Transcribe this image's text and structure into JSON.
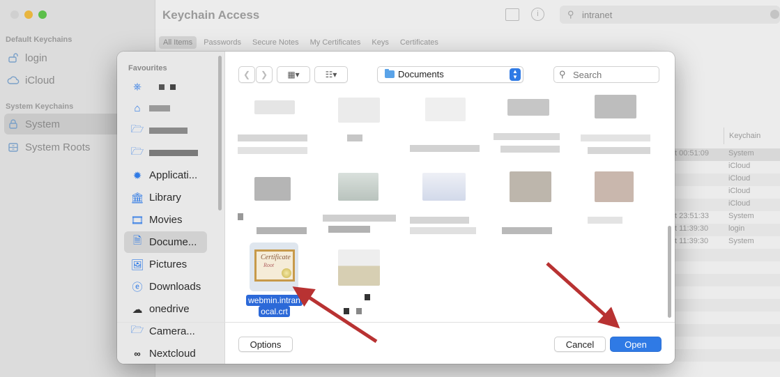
{
  "keychain": {
    "title": "Keychain Access",
    "search_value": "intranet",
    "sections": {
      "default": "Default Keychains",
      "system": "System Keychains"
    },
    "keychains_default": [
      "login",
      "iCloud"
    ],
    "keychains_system": [
      "System",
      "System Roots"
    ],
    "tabs": [
      "All Items",
      "Passwords",
      "Secure Notes",
      "My Certificates",
      "Keys",
      "Certificates"
    ],
    "column_keychain": "Keychain",
    "rows": [
      {
        "date": "t 00:51:09",
        "keychain": "System"
      },
      {
        "date": "",
        "keychain": "iCloud"
      },
      {
        "date": "",
        "keychain": "iCloud"
      },
      {
        "date": "",
        "keychain": "iCloud"
      },
      {
        "date": "",
        "keychain": "iCloud"
      },
      {
        "date": "t 23:51:33",
        "keychain": "System"
      },
      {
        "date": "t 11:39:30",
        "keychain": "login"
      },
      {
        "date": "t 11:39:30",
        "keychain": "System"
      }
    ]
  },
  "dialog": {
    "sidebar_title": "Favourites",
    "sidebar_items": [
      {
        "label": "",
        "icon": "network-icon"
      },
      {
        "label": "",
        "icon": "home-icon"
      },
      {
        "label": "",
        "icon": "folder-icon"
      },
      {
        "label": "",
        "icon": "folder-icon"
      },
      {
        "label": "Applicati...",
        "icon": "apps-icon"
      },
      {
        "label": "Library",
        "icon": "library-icon"
      },
      {
        "label": "Movies",
        "icon": "movies-icon"
      },
      {
        "label": "Docume...",
        "icon": "document-icon"
      },
      {
        "label": "Pictures",
        "icon": "pictures-icon"
      },
      {
        "label": "Downloads",
        "icon": "downloads-icon"
      },
      {
        "label": "onedrive",
        "icon": "cloud-icon"
      },
      {
        "label": "Camera...",
        "icon": "folder-icon"
      },
      {
        "label": "Nextcloud",
        "icon": "nextcloud-icon"
      }
    ],
    "location": "Documents",
    "search_placeholder": "Search",
    "selected_file": "webmin.intranet.local.crt",
    "selected_file_line1": "webmin.intran",
    "selected_file_line1b": "ocal.crt",
    "options_label": "Options",
    "cancel_label": "Cancel",
    "open_label": "Open",
    "accent": "#2f7ae5",
    "annotation_arrow_color": "#b83232"
  }
}
